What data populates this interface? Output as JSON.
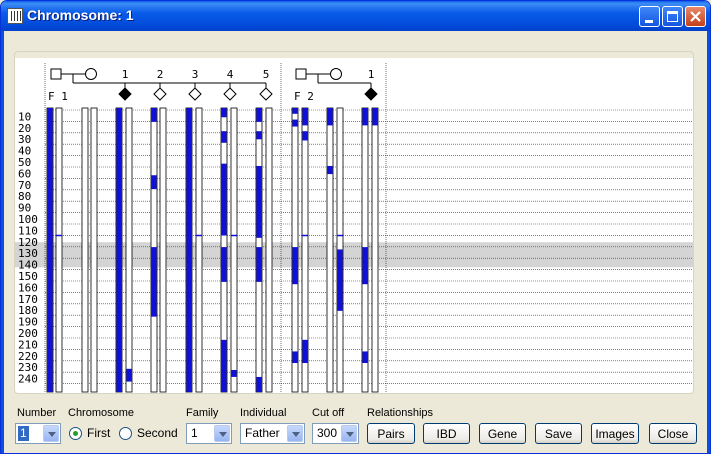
{
  "window": {
    "title": "Chromosome: 1"
  },
  "plot": {
    "fam1": {
      "label": "F 1",
      "numbers": [
        "1",
        "2",
        "3",
        "4",
        "5"
      ]
    },
    "fam2": {
      "label": "F 2",
      "numbers": [
        "1"
      ]
    },
    "yticks": [
      "10",
      "20",
      "30",
      "40",
      "50",
      "60",
      "70",
      "80",
      "90",
      "100",
      "110",
      "120",
      "130",
      "140",
      "150",
      "160",
      "170",
      "180",
      "190",
      "200",
      "210",
      "220",
      "230",
      "240"
    ],
    "colors": {
      "segment": "#1010D8",
      "highlight": "#D4D4D4"
    }
  },
  "controls": {
    "number": {
      "label": "Number",
      "value": "1"
    },
    "chromosome": {
      "label": "Chromosome",
      "first": "First",
      "second": "Second",
      "selected": "First"
    },
    "family": {
      "label": "Family",
      "value": "1"
    },
    "individual": {
      "label": "Individual",
      "value": "Father"
    },
    "cutoff": {
      "label": "Cut off",
      "value": "300"
    },
    "relationships": {
      "label": "Relationships"
    },
    "buttons": {
      "pairs": "Pairs",
      "ibd": "IBD",
      "gene": "Gene",
      "save": "Save",
      "images": "Images",
      "close": "Close"
    }
  }
}
